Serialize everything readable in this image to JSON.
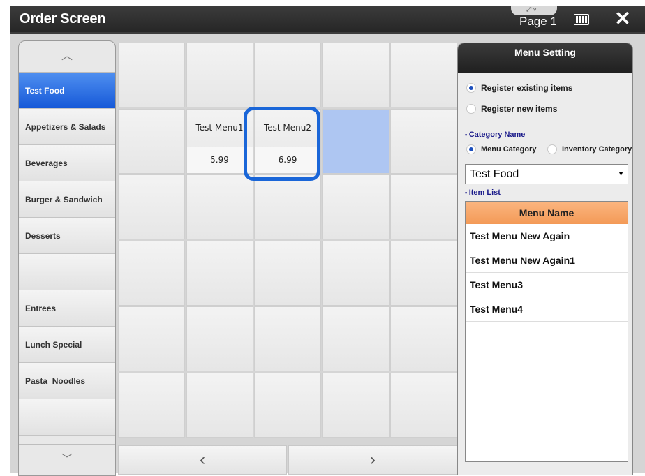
{
  "window": {
    "title": "Order Screen",
    "page_label": "Page 1",
    "close_glyph": "✕",
    "notch_glyphs": "⤢ ∨"
  },
  "sidebar": {
    "up_arrow": "︿",
    "down_arrow": "﹀",
    "items": [
      {
        "label": "Test Food",
        "active": true
      },
      {
        "label": "Appetizers & Salads"
      },
      {
        "label": "Beverages"
      },
      {
        "label": "Burger & Sandwich"
      },
      {
        "label": "Desserts"
      },
      {
        "label": ""
      },
      {
        "label": "Entrees"
      },
      {
        "label": "Lunch Special"
      },
      {
        "label": "Pasta_Noodles"
      },
      {
        "label": ""
      }
    ]
  },
  "menu_grid": {
    "rows": 6,
    "cols": 5,
    "items": [
      {
        "row": 1,
        "col": 1,
        "name": "Test Menu1",
        "price": "5.99"
      },
      {
        "row": 1,
        "col": 2,
        "name": "Test Menu2",
        "price": "6.99"
      }
    ],
    "selected_cell": {
      "row": 1,
      "col": 3
    }
  },
  "pager": {
    "prev": "‹",
    "next": "›"
  },
  "menu_setting": {
    "title": "Menu Setting",
    "register_existing": "Register existing items",
    "register_new": "Register new items",
    "category_name_label": "Category Name",
    "menu_category": "Menu Category",
    "inventory_category": "Inventory Category",
    "category_select_value": "Test Food",
    "item_list_label": "Item List",
    "item_list_header": "Menu Name",
    "items": [
      "Test Menu New Again",
      "Test Menu New Again1",
      "Test Menu3",
      "Test Menu4"
    ]
  }
}
